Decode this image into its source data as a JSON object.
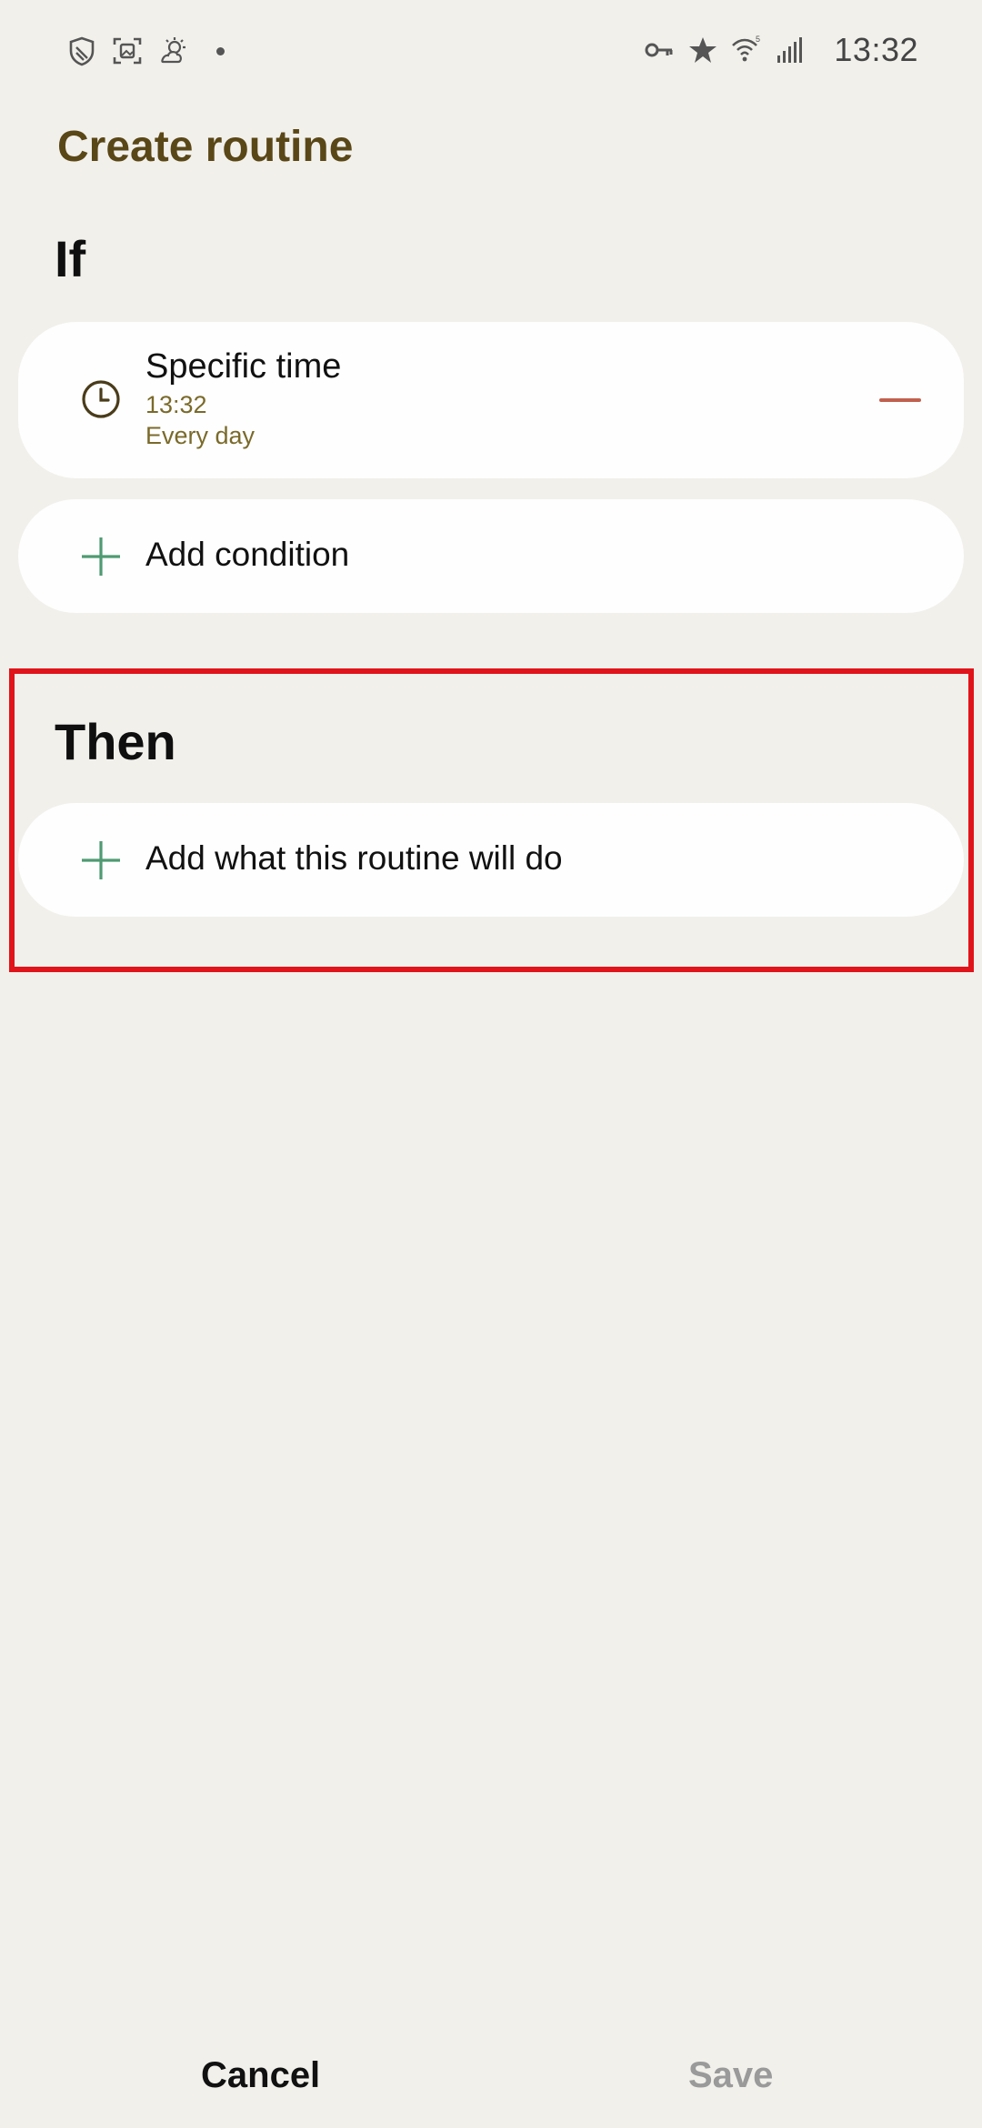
{
  "status_bar": {
    "time": "13:32",
    "left_icons": [
      "shield-icon",
      "screenshot-icon",
      "weather-icon",
      "notification-dot"
    ],
    "right_icons": [
      "key-icon",
      "star-icon",
      "wifi-icon",
      "signal-icon"
    ]
  },
  "page": {
    "title": "Create routine"
  },
  "if_section": {
    "heading": "If",
    "condition": {
      "icon": "clock-icon",
      "title": "Specific time",
      "time": "13:32",
      "repeat": "Every day"
    },
    "add_condition_label": "Add condition"
  },
  "then_section": {
    "heading": "Then",
    "add_action_label": "Add what this routine will do"
  },
  "bottom_bar": {
    "cancel_label": "Cancel",
    "save_label": "Save"
  },
  "colors": {
    "background": "#f2f0eb",
    "title": "#5a4717",
    "accent_green": "#4f9a72",
    "remove_red": "#c0604f",
    "highlight": "#e0141b",
    "disabled_text": "#9a9a9a"
  }
}
